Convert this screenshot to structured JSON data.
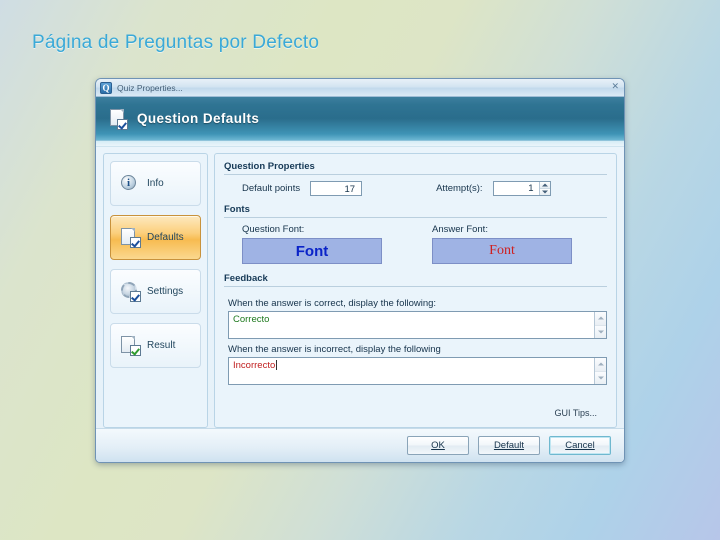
{
  "slide": {
    "title": "Página de Preguntas por Defecto"
  },
  "dialog": {
    "titlebar": {
      "text": "Quiz Properties...",
      "icon": "Q",
      "close": "✕"
    },
    "header": {
      "title": "Question Defaults"
    },
    "sidebar": {
      "items": [
        {
          "label": "Info",
          "icon": "info-globe-icon",
          "selected": false
        },
        {
          "label": "Defaults",
          "icon": "document-check-icon",
          "selected": true
        },
        {
          "label": "Settings",
          "icon": "gear-check-icon",
          "selected": false
        },
        {
          "label": "Result",
          "icon": "document-check-gear-icon",
          "selected": false
        }
      ]
    },
    "question_properties": {
      "group_label": "Question Properties",
      "default_points_label": "Default points",
      "default_points_value": "17",
      "attempts_label": "Attempt(s):",
      "attempts_value": "1"
    },
    "fonts": {
      "group_label": "Fonts",
      "question_font_label": "Question Font:",
      "question_font_sample": "Font",
      "question_font_color": "#0a23c8",
      "answer_font_label": "Answer Font:",
      "answer_font_sample": "Font",
      "answer_font_color": "#cf1f1f",
      "swatch_color": "#9fb3e4"
    },
    "feedback": {
      "group_label": "Feedback",
      "correct_label": "When the answer is correct,  display the following:",
      "correct_value": "Correcto",
      "correct_color": "#1f7a1f",
      "incorrect_label": "When the answer is incorrect,  display the following",
      "incorrect_value": "Incorrecto",
      "incorrect_color": "#c02020"
    },
    "tips_link": "GUI Tips...",
    "buttons": {
      "ok": "OK",
      "default": "Default",
      "cancel": "Cancel"
    }
  }
}
